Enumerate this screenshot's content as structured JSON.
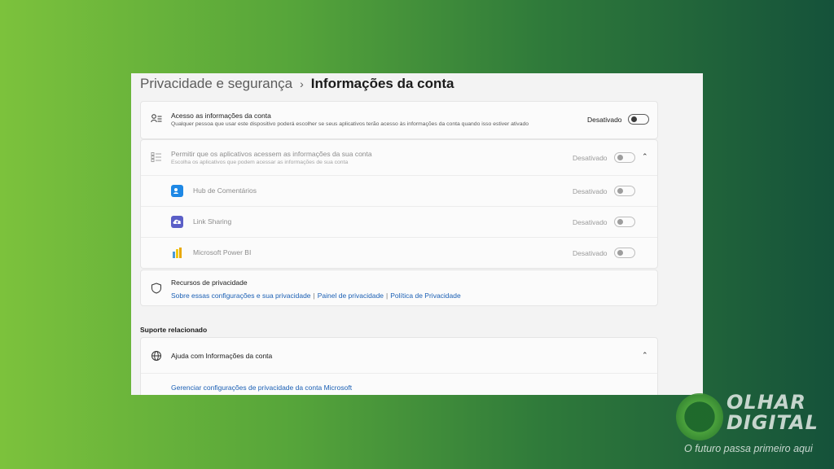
{
  "breadcrumb": {
    "parent": "Privacidade e segurança",
    "separator": "›",
    "current": "Informações da conta"
  },
  "account_access": {
    "icon": "person-list-icon",
    "title": "Acesso as informações da conta",
    "description": "Qualquer pessoa que usar este dispositivo poderá escolher se seus aplicativos terão acesso às informações da conta quando isso estiver ativado",
    "status": "Desativado",
    "toggle_on": false
  },
  "apps_access": {
    "icon": "checklist-icon",
    "title": "Permitir que os aplicativos acessem as informações da sua conta",
    "description": "Escolha os aplicativos que podem acessar as informações de sua conta",
    "status": "Desativado",
    "toggle_on": false,
    "expanded": true,
    "apps": [
      {
        "name": "Hub de Comentários",
        "status": "Desativado",
        "icon": "feedback-hub-icon",
        "color": "#1e88e5"
      },
      {
        "name": "Link Sharing",
        "status": "Desativado",
        "icon": "cloud-upload-icon",
        "color": "#5b5fc7"
      },
      {
        "name": "Microsoft Power BI",
        "status": "Desativado",
        "icon": "power-bi-icon",
        "color": "#f2c811"
      }
    ]
  },
  "privacy_resources": {
    "icon": "shield-icon",
    "title": "Recursos de privacidade",
    "links": [
      "Sobre essas configurações e sua privacidade",
      "Painel de privacidade",
      "Política de Privacidade"
    ],
    "separator": "|"
  },
  "related_support": {
    "section_title": "Suporte relacionado",
    "item": {
      "icon": "globe-icon",
      "title": "Ajuda com Informações da conta",
      "expanded": true,
      "link": "Gerenciar configurações de privacidade da conta Microsoft"
    }
  },
  "watermark": {
    "logo_line1": "OLHAR",
    "logo_line2": "DIGITAL",
    "tagline": "O futuro passa primeiro aqui"
  },
  "colors": {
    "link": "#1a5fb4",
    "background_gradient_start": "#7cc23c",
    "background_gradient_end": "#15523a"
  }
}
